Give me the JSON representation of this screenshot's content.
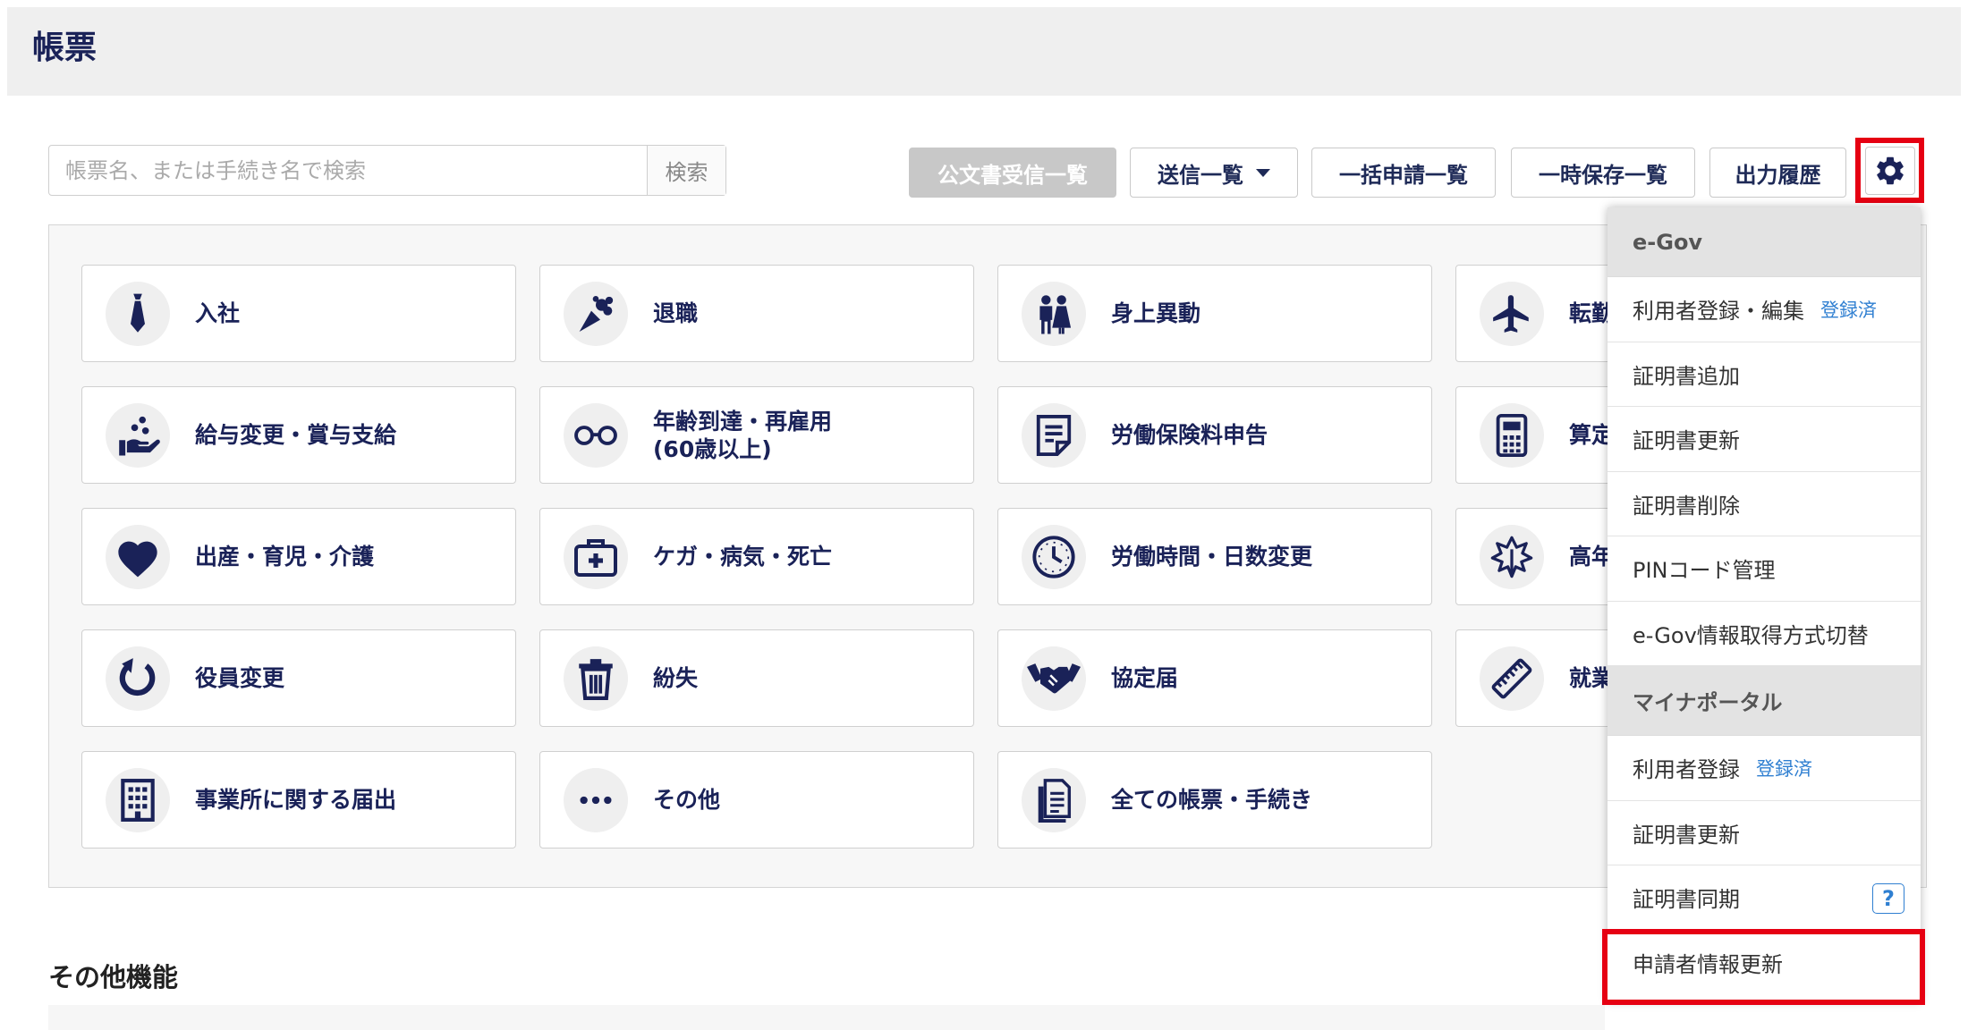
{
  "page": {
    "title": "帳票"
  },
  "search": {
    "placeholder": "帳票名、または手続き名で検索",
    "button_label": "検索"
  },
  "toolbar": {
    "official_docs_label": "公文書受信一覧",
    "send_list_label": "送信一覧",
    "bulk_apply_label": "一括申請一覧",
    "temp_save_label": "一時保存一覧",
    "output_history_label": "出力履歴"
  },
  "cards": [
    {
      "label": "入社",
      "icon": "necktie-icon"
    },
    {
      "label": "退職",
      "icon": "bouquet-icon"
    },
    {
      "label": "身上異動",
      "icon": "wedding-couple-icon"
    },
    {
      "label": "転勤",
      "icon": "airplane-icon"
    },
    {
      "label": "給与変更・賞与支給",
      "icon": "hand-coins-icon"
    },
    {
      "label": "年齢到達・再雇用\n(60歳以上)",
      "icon": "glasses-icon"
    },
    {
      "label": "労働保険料申告",
      "icon": "document-icon"
    },
    {
      "label": "算定",
      "icon": "calculator-icon"
    },
    {
      "label": "出産・育児・介護",
      "icon": "heart-icon"
    },
    {
      "label": "ケガ・病気・死亡",
      "icon": "first-aid-kit-icon"
    },
    {
      "label": "労働時間・日数変更",
      "icon": "clock-icon"
    },
    {
      "label": "高年",
      "icon": "leaf-icon"
    },
    {
      "label": "役員変更",
      "icon": "refresh-icon"
    },
    {
      "label": "紛失",
      "icon": "trash-icon"
    },
    {
      "label": "協定届",
      "icon": "handshake-icon"
    },
    {
      "label": "就業",
      "icon": "ruler-icon"
    },
    {
      "label": "事業所に関する届出",
      "icon": "building-icon"
    },
    {
      "label": "その他",
      "icon": "more-dots-icon"
    },
    {
      "label": "全ての帳票・手続き",
      "icon": "documents-icon"
    }
  ],
  "dropdown": {
    "egov": {
      "header": "e-Gov",
      "items": [
        {
          "label": "利用者登録・編集",
          "badge": "登録済"
        },
        {
          "label": "証明書追加"
        },
        {
          "label": "証明書更新"
        },
        {
          "label": "証明書削除"
        },
        {
          "label": "PINコード管理"
        },
        {
          "label": "e-Gov情報取得方式切替"
        }
      ]
    },
    "mynaportal": {
      "header": "マイナポータル",
      "items": [
        {
          "label": "利用者登録",
          "badge": "登録済"
        },
        {
          "label": "証明書更新"
        },
        {
          "label": "証明書同期",
          "help": "?"
        },
        {
          "label": "申請者情報更新"
        }
      ]
    }
  },
  "other_features": {
    "title": "その他機能"
  },
  "colors": {
    "navy": "#1a2258",
    "highlight_red": "#e60012",
    "link_blue": "#2f7fd1"
  }
}
